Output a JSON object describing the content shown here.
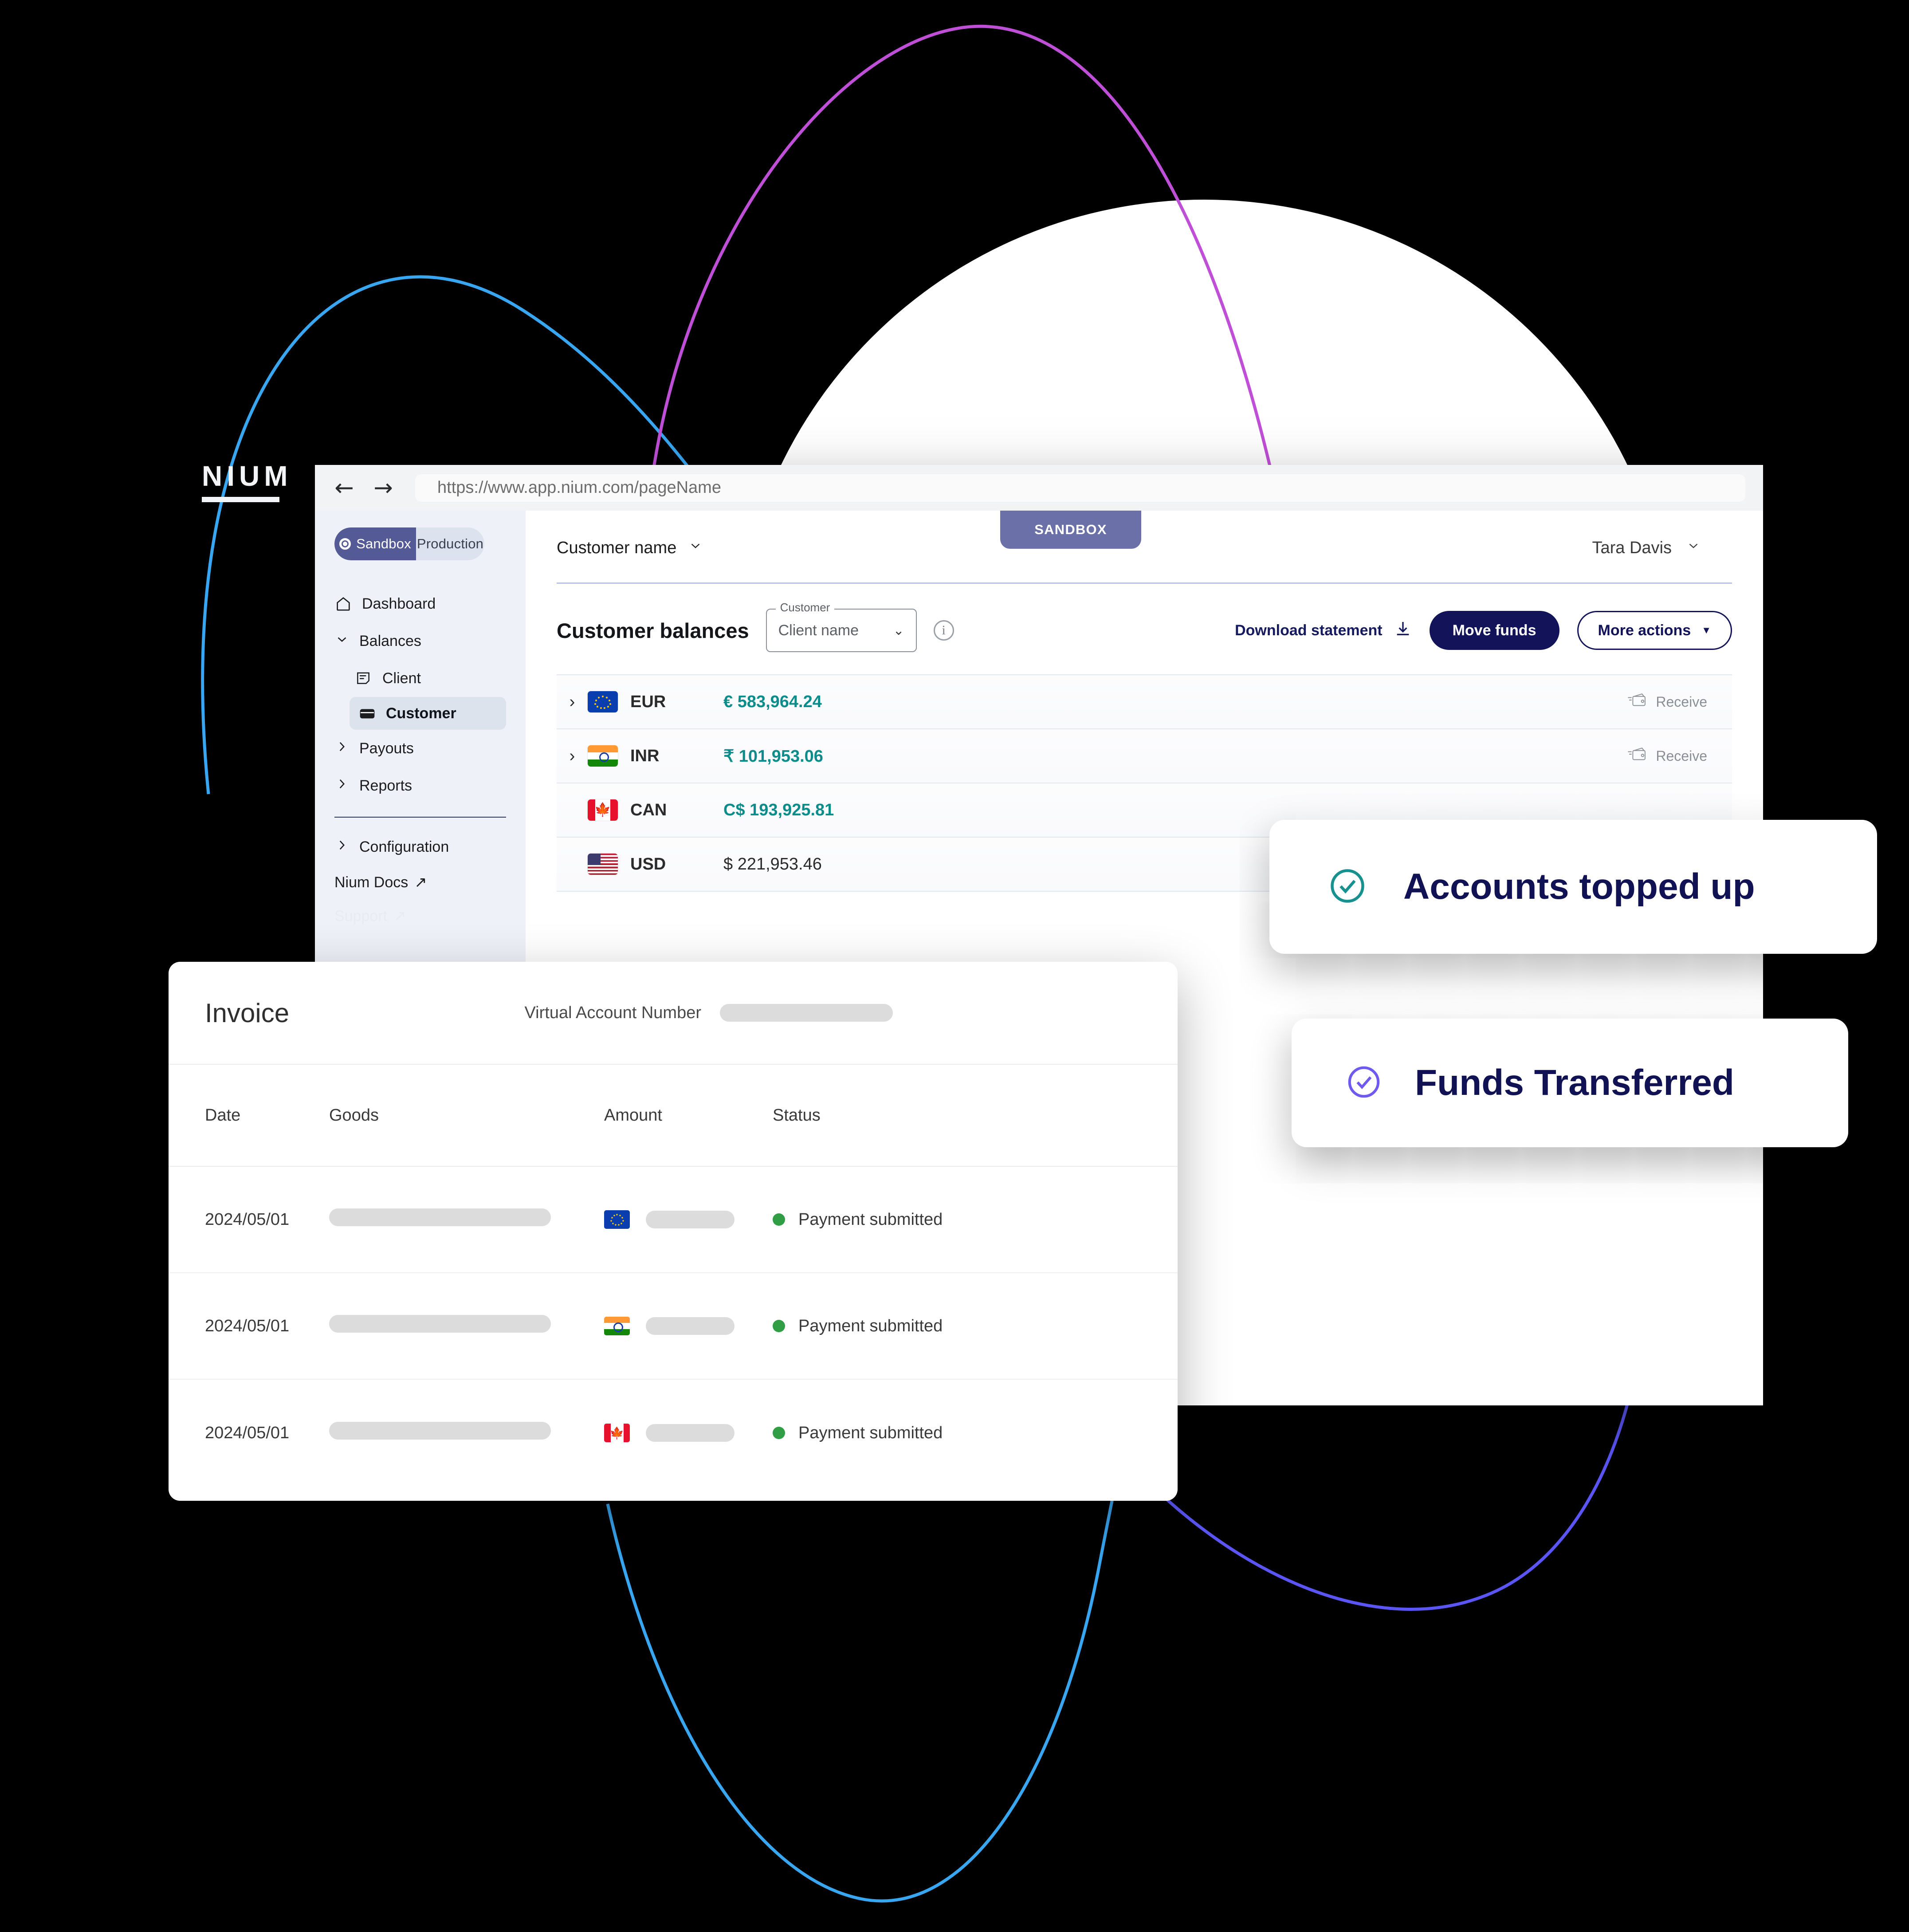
{
  "browser": {
    "back_icon": "arrow-left-icon",
    "forward_icon": "arrow-right-icon",
    "url": "https://www.app.nium.com/pageName"
  },
  "sidebar": {
    "env_toggle": {
      "active": "Sandbox",
      "inactive": "Production"
    },
    "items": [
      {
        "label": "Dashboard",
        "icon": "home-icon"
      },
      {
        "label": "Balances",
        "icon": "chevron-down-icon"
      },
      {
        "label": "Client",
        "icon": "document-icon"
      },
      {
        "label": "Customer",
        "icon": "wallet-icon"
      },
      {
        "label": "Payouts",
        "icon": "chevron-right-icon"
      },
      {
        "label": "Reports",
        "icon": "chevron-right-icon"
      },
      {
        "label": "Configuration",
        "icon": "chevron-right-icon"
      }
    ],
    "external": [
      {
        "label": "Nium Docs",
        "icon": "external-link-icon"
      },
      {
        "label": "Support",
        "icon": "external-link-icon"
      }
    ]
  },
  "header": {
    "sandbox_badge": "SANDBOX",
    "customer_name_select": "Customer name",
    "user_name": "Tara Davis"
  },
  "balances": {
    "title": "Customer balances",
    "customer_field": {
      "legend": "Customer",
      "value": "Client name"
    },
    "info_icon": "info-icon",
    "download_label": "Download statement",
    "download_icon": "download-icon",
    "move_funds_label": "Move funds",
    "more_actions_label": "More actions",
    "receive_label": "Receive",
    "accent_teal": "#0d8c8c",
    "accent_navy": "#121358",
    "rows": [
      {
        "currency": "EUR",
        "flag": "eu-flag",
        "amount": "€ 583,964.24",
        "expandable": true,
        "receive": true
      },
      {
        "currency": "INR",
        "flag": "in-flag",
        "amount": "₹ 101,953.06",
        "expandable": true,
        "receive": true
      },
      {
        "currency": "CAN",
        "flag": "ca-flag",
        "amount": "C$ 193,925.81",
        "expandable": false,
        "receive": false
      },
      {
        "currency": "USD",
        "flag": "us-flag",
        "amount": "$ 221,953.46",
        "expandable": false,
        "receive": false
      }
    ]
  },
  "invoice": {
    "title": "Invoice",
    "van_label": "Virtual Account Number",
    "watermark": "NIUM",
    "columns": {
      "date": "Date",
      "goods": "Goods",
      "amount": "Amount",
      "status": "Status"
    },
    "rows": [
      {
        "date": "2024/05/01",
        "flag": "eu-flag",
        "status": "Payment submitted",
        "status_color": "#2f9e44"
      },
      {
        "date": "2024/05/01",
        "flag": "in-flag",
        "status": "Payment submitted",
        "status_color": "#2f9e44"
      },
      {
        "date": "2024/05/01",
        "flag": "ca-flag",
        "status": "Payment submitted",
        "status_color": "#2f9e44"
      }
    ]
  },
  "toasts": [
    {
      "label": "Accounts topped up",
      "icon": "check-circle-icon",
      "color": "#17918f"
    },
    {
      "label": "Funds Transferred",
      "icon": "check-circle-icon",
      "color": "#6f5af0"
    }
  ],
  "decor": {
    "curve_cyan": "#38a6f0",
    "curve_blue": "#5b55f5",
    "curve_magenta": "#c04fd8",
    "background": "#000000"
  }
}
